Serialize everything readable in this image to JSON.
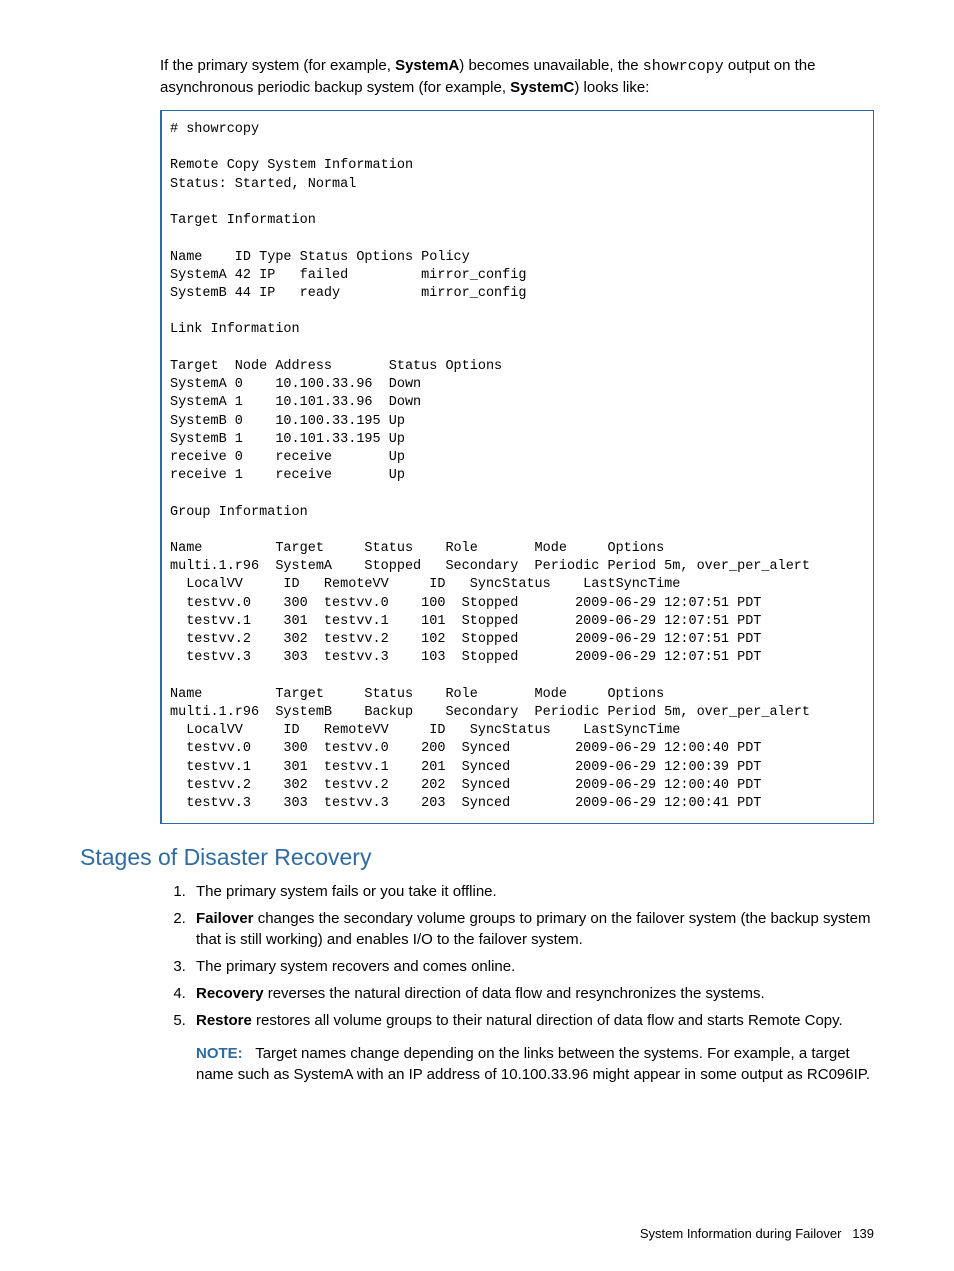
{
  "intro": {
    "p1a": "If the primary system (for example, ",
    "p1b": "SystemA",
    "p1c": ") becomes unavailable, the ",
    "p1d": "showrcopy",
    "p1e": " output on the asynchronous periodic backup system (for example, ",
    "p1f": "SystemC",
    "p1g": ") looks like:"
  },
  "code": "# showrcopy\n\nRemote Copy System Information\nStatus: Started, Normal\n\nTarget Information\n\nName    ID Type Status Options Policy\nSystemA 42 IP   failed         mirror_config\nSystemB 44 IP   ready          mirror_config\n\nLink Information\n\nTarget  Node Address       Status Options\nSystemA 0    10.100.33.96  Down\nSystemA 1    10.101.33.96  Down\nSystemB 0    10.100.33.195 Up\nSystemB 1    10.101.33.195 Up\nreceive 0    receive       Up\nreceive 1    receive       Up\n\nGroup Information\n\nName         Target     Status    Role       Mode     Options\nmulti.1.r96  SystemA    Stopped   Secondary  Periodic Period 5m, over_per_alert\n  LocalVV     ID   RemoteVV     ID   SyncStatus    LastSyncTime\n  testvv.0    300  testvv.0    100  Stopped       2009-06-29 12:07:51 PDT\n  testvv.1    301  testvv.1    101  Stopped       2009-06-29 12:07:51 PDT\n  testvv.2    302  testvv.2    102  Stopped       2009-06-29 12:07:51 PDT\n  testvv.3    303  testvv.3    103  Stopped       2009-06-29 12:07:51 PDT\n\nName         Target     Status    Role       Mode     Options\nmulti.1.r96  SystemB    Backup    Secondary  Periodic Period 5m, over_per_alert\n  LocalVV     ID   RemoteVV     ID   SyncStatus    LastSyncTime\n  testvv.0    300  testvv.0    200  Synced        2009-06-29 12:00:40 PDT\n  testvv.1    301  testvv.1    201  Synced        2009-06-29 12:00:39 PDT\n  testvv.2    302  testvv.2    202  Synced        2009-06-29 12:00:40 PDT\n  testvv.3    303  testvv.3    203  Synced        2009-06-29 12:00:41 PDT",
  "heading": "Stages of Disaster Recovery",
  "steps": {
    "s1": "The primary system fails or you take it offline.",
    "s2a": "Failover",
    "s2b": " changes the secondary volume groups to primary on the failover system (the backup system that is still working) and enables I/O to the failover system.",
    "s3": "The primary system recovers and comes online.",
    "s4a": "Recovery",
    "s4b": " reverses the natural direction of data flow and resynchronizes the systems.",
    "s5a": "Restore",
    "s5b": " restores all volume groups to their natural direction of data flow and starts Remote Copy."
  },
  "note": {
    "label": "NOTE:",
    "text": "Target names change depending on the links between the systems. For example, a target name such as SystemA with an IP address of 10.100.33.96 might appear in some output as RC096IP."
  },
  "footer": {
    "title": "System Information during Failover",
    "page": "139"
  }
}
